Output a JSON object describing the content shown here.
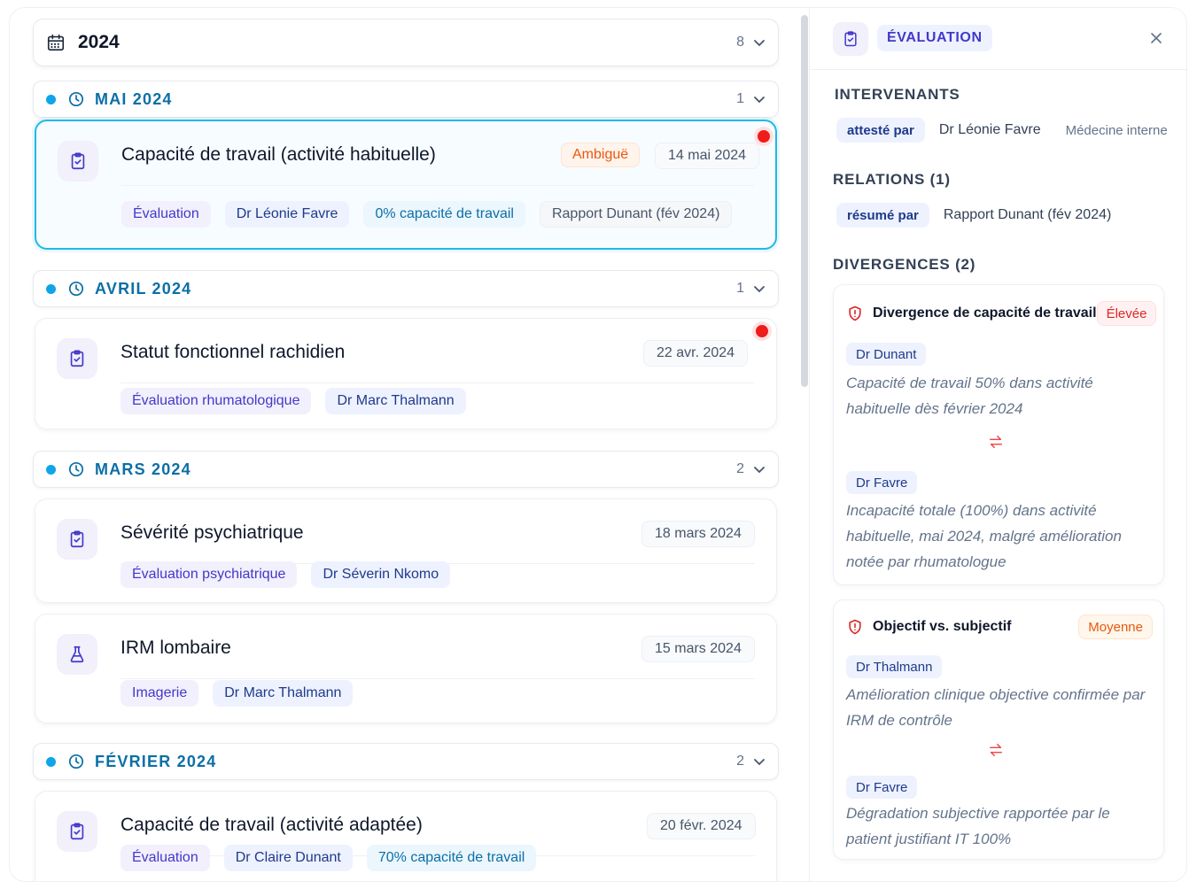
{
  "timeline": {
    "year": {
      "label": "2024",
      "count": "8"
    },
    "months": [
      {
        "label": "MAI 2024",
        "count": "1"
      },
      {
        "label": "AVRIL 2024",
        "count": "1"
      },
      {
        "label": "MARS 2024",
        "count": "2"
      },
      {
        "label": "FÉVRIER 2024",
        "count": "2"
      }
    ],
    "cards": [
      {
        "title": "Capacité de travail (activité habituelle)",
        "flag": "Ambiguë",
        "date": "14 mai 2024",
        "tags": [
          "Évaluation",
          "Dr Léonie Favre",
          "0% capacité de travail",
          "Rapport Dunant (fév 2024)"
        ],
        "icon": "clipboard-check-icon"
      },
      {
        "title": "Statut fonctionnel rachidien",
        "date": "22 avr. 2024",
        "tags": [
          "Évaluation rhumatologique",
          "Dr Marc Thalmann"
        ],
        "icon": "clipboard-check-icon"
      },
      {
        "title": "Sévérité psychiatrique",
        "date": "18 mars 2024",
        "tags": [
          "Évaluation psychiatrique",
          "Dr Séverin Nkomo"
        ],
        "icon": "clipboard-check-icon"
      },
      {
        "title": "IRM lombaire",
        "date": "15 mars 2024",
        "tags": [
          "Imagerie",
          "Dr Marc Thalmann"
        ],
        "icon": "flask-icon"
      },
      {
        "title": "Capacité de travail (activité adaptée)",
        "date": "20 févr. 2024",
        "tags": [
          "Évaluation",
          "Dr Claire Dunant",
          "70% capacité de travail"
        ],
        "icon": "clipboard-check-icon"
      }
    ]
  },
  "panel": {
    "title": "ÉVALUATION",
    "intervenants": {
      "heading": "INTERVENANTS",
      "relation": "attesté par",
      "name": "Dr Léonie Favre",
      "specialty": "Médecine interne"
    },
    "relations": {
      "heading": "RELATIONS (1)",
      "relation": "résumé par",
      "name": "Rapport Dunant (fév 2024)"
    },
    "divergences": {
      "heading": "DIVERGENCES (2)",
      "items": [
        {
          "title": "Divergence de capacité de travail",
          "severity": "Élevée",
          "a_doc": "Dr Dunant",
          "a_text": "Capacité de travail 50% dans activité habituelle dès février 2024",
          "b_doc": "Dr Favre",
          "b_text": "Incapacité totale (100%) dans activité habituelle, mai 2024, malgré amélioration notée par rhumatologue"
        },
        {
          "title": "Objectif vs. subjectif",
          "severity": "Moyenne",
          "a_doc": "Dr Thalmann",
          "a_text": "Amélioration clinique objective confirmée par IRM de contrôle",
          "b_doc": "Dr Favre",
          "b_text": "Dégradation subjective rapportée par le patient justifiant IT 100%"
        }
      ]
    }
  },
  "colors": {
    "accent": "#0ea5e9",
    "indigo": "#4338ca",
    "alert": "#ef1c1c"
  }
}
